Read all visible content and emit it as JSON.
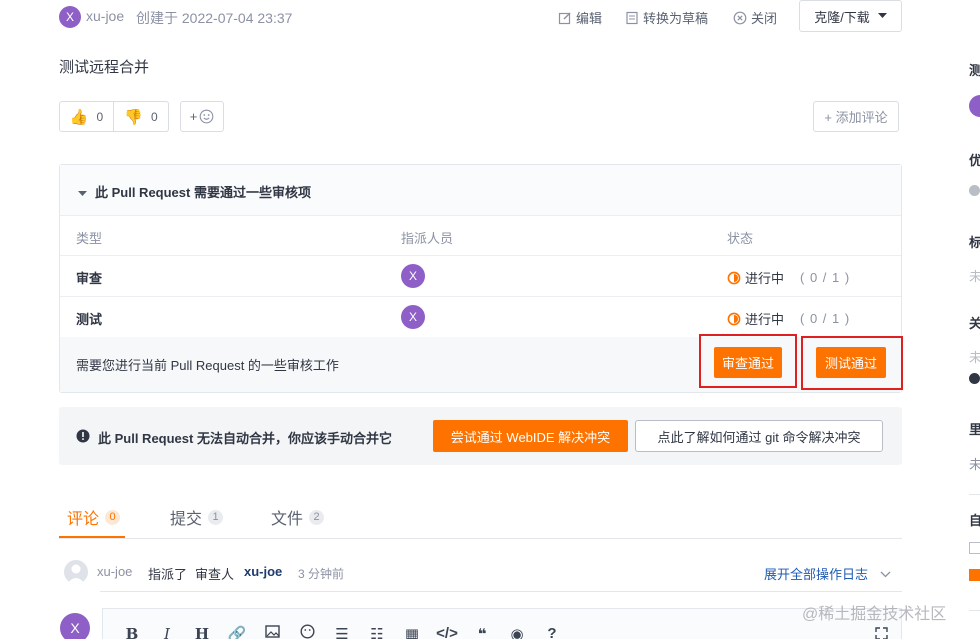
{
  "header": {
    "author_avatar": "X",
    "author": "xu-joe",
    "created": "创建于 2022-07-04 23:37",
    "actions": {
      "edit": "编辑",
      "draft": "转换为草稿",
      "close": "关闭"
    },
    "clone_download": "克隆/下载"
  },
  "pr": {
    "title": "测试远程合并"
  },
  "reactions": {
    "thumbs_up": "0",
    "thumbs_down": "0",
    "add": "+",
    "add_comment": "+ 添加评论"
  },
  "review": {
    "heading": "此 Pull Request 需要通过一些审核项",
    "columns": {
      "type": "类型",
      "assignee": "指派人员",
      "status": "状态"
    },
    "rows": [
      {
        "type": "审查",
        "avatar": "X",
        "status": "进行中",
        "progress": "( 0 / 1 )"
      },
      {
        "type": "测试",
        "avatar": "X",
        "status": "进行中",
        "progress": "( 0 / 1 )"
      }
    ],
    "notice": "需要您进行当前 Pull Request 的一些审核工作",
    "approve_review": "审查通过",
    "approve_test": "测试通过"
  },
  "merge": {
    "message": "此 Pull Request 无法自动合并，你应该手动合并它",
    "webide_button": "尝试通过 WebIDE 解决冲突",
    "git_help_button": "点此了解如何通过 git 命令解决冲突"
  },
  "tabs": [
    {
      "label": "评论",
      "count": "0"
    },
    {
      "label": "提交",
      "count": "1"
    },
    {
      "label": "文件",
      "count": "2"
    }
  ],
  "activity": {
    "user": "xu-joe",
    "action": "指派了",
    "role": "审查人",
    "target": "xu-joe",
    "time": "3 分钟前",
    "expand_log": "展开全部操作日志"
  },
  "editor": {
    "avatar": "X",
    "toolbar": [
      "B",
      "I",
      "H"
    ]
  },
  "sidebar": {
    "fragments": [
      "测",
      "优",
      "标",
      "未",
      "关",
      "未",
      "里",
      "未",
      "自"
    ]
  },
  "watermark": "@稀土掘金技术社区",
  "colors": {
    "accent": "#fe7300",
    "avatar": "#8e5fc6",
    "link": "#1f5bb3",
    "highlight": "#e02020"
  }
}
